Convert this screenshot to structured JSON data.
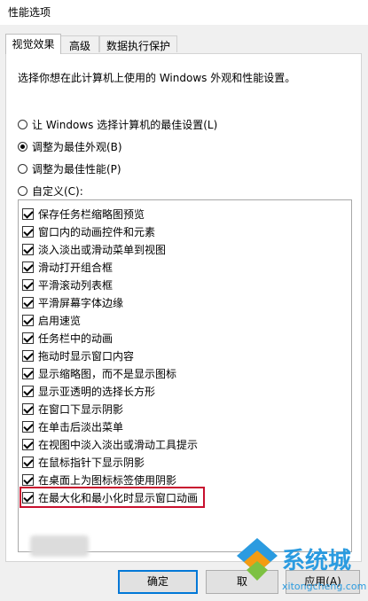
{
  "window": {
    "title": "性能选项"
  },
  "tabs": [
    {
      "label": "视觉效果",
      "active": true
    },
    {
      "label": "高级",
      "active": false
    },
    {
      "label": "数据执行保护",
      "active": false
    }
  ],
  "panel": {
    "description": "选择你想在此计算机上使用的 Windows 外观和性能设置。",
    "radios": [
      {
        "label": "让 Windows 选择计算机的最佳设置(L)",
        "checked": false
      },
      {
        "label": "调整为最佳外观(B)",
        "checked": true
      },
      {
        "label": "调整为最佳性能(P)",
        "checked": false
      },
      {
        "label": "自定义(C):",
        "checked": false
      }
    ],
    "effects": [
      {
        "label": "保存任务栏缩略图预览",
        "checked": true
      },
      {
        "label": "窗口内的动画控件和元素",
        "checked": true
      },
      {
        "label": "淡入淡出或滑动菜单到视图",
        "checked": true
      },
      {
        "label": "滑动打开组合框",
        "checked": true
      },
      {
        "label": "平滑滚动列表框",
        "checked": true
      },
      {
        "label": "平滑屏幕字体边缘",
        "checked": true
      },
      {
        "label": "启用速览",
        "checked": true
      },
      {
        "label": "任务栏中的动画",
        "checked": true
      },
      {
        "label": "拖动时显示窗口内容",
        "checked": true
      },
      {
        "label": "显示缩略图，而不是显示图标",
        "checked": true
      },
      {
        "label": "显示亚透明的选择长方形",
        "checked": true
      },
      {
        "label": "在窗口下显示阴影",
        "checked": true
      },
      {
        "label": "在单击后淡出菜单",
        "checked": true
      },
      {
        "label": "在视图中淡入淡出或滑动工具提示",
        "checked": true
      },
      {
        "label": "在鼠标指针下显示阴影",
        "checked": true
      },
      {
        "label": "在桌面上为图标标签使用阴影",
        "checked": true
      },
      {
        "label": "在最大化和最小化时显示窗口动画",
        "checked": true,
        "highlighted": true
      }
    ]
  },
  "buttons": {
    "ok": "确定",
    "cancel": "取",
    "apply": "应用(A)"
  },
  "watermark": {
    "name": "系统城",
    "url": "xitongcheng.com",
    "color": "#2b9be0"
  },
  "colors": {
    "highlight_border": "#c8102e",
    "accent": "#0078d7"
  }
}
